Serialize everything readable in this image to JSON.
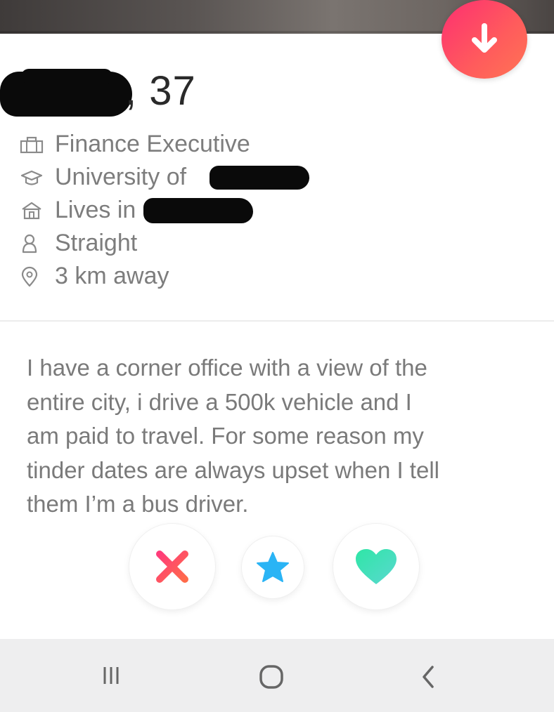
{
  "profile": {
    "age_text": ", 37"
  },
  "info": {
    "job": "Finance Executive",
    "school_prefix": "University of",
    "lives_prefix": "Lives in",
    "orientation": "Straight",
    "distance": "3 km away"
  },
  "bio": {
    "line1": "I have a corner office with a view of the",
    "line2": "entire city, i drive a 500k vehicle and I",
    "line3": "am paid to travel. For some reason my",
    "line4": "tinder dates are always upset when I tell",
    "line5": "them I’m a bus driver."
  },
  "colors": {
    "nope": "#ff4e5c",
    "super_like": "#2ab4f5",
    "like": "#3ee0b4",
    "down_button": "#fd3f6c"
  },
  "icons": {
    "down": "arrow-down-icon",
    "job": "briefcase-icon",
    "school": "graduation-cap-icon",
    "home": "house-icon",
    "orientation": "person-icon",
    "distance": "location-pin-icon",
    "nope": "x-icon",
    "super_like": "star-icon",
    "like": "heart-icon",
    "recents": "recents-icon",
    "home_nav": "home-icon",
    "back": "back-icon"
  }
}
